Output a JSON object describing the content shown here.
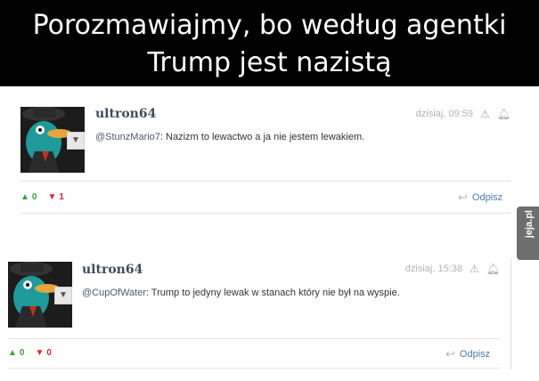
{
  "header": {
    "line1": "Porozmawiajmy, bo według agentki",
    "line2": "Trump jest nazistą"
  },
  "comments": [
    {
      "username": "ultron64",
      "timestamp": "dzisiaj, 09:59",
      "mention": "@StunzMario7",
      "text": ": Nazizm to lewactwo a ja nie jestem lewakiem.",
      "upvotes": "0",
      "downvotes": "1",
      "reply_label": "Odpisz"
    },
    {
      "username": "ultron64",
      "timestamp": "dzisiaj, 15:38",
      "mention": "@CupOfWater",
      "text": ": Trump to jedyny lewak w stanach który nie był na wyspie.",
      "upvotes": "0",
      "downvotes": "0",
      "reply_label": "Odpisz"
    }
  ],
  "badge": {
    "logo": "jeja.pl"
  },
  "icons": {
    "upvote": "triangle-up-icon",
    "downvote": "triangle-down-icon",
    "report": "warning-icon",
    "notify": "bell-icon",
    "reply": "reply-arrow-icon",
    "avatar_menu": "chevron-down-icon"
  },
  "colors": {
    "up": "#3ea040",
    "down": "#d82a2a",
    "link": "#4d78b0",
    "username": "#3f4d60"
  }
}
